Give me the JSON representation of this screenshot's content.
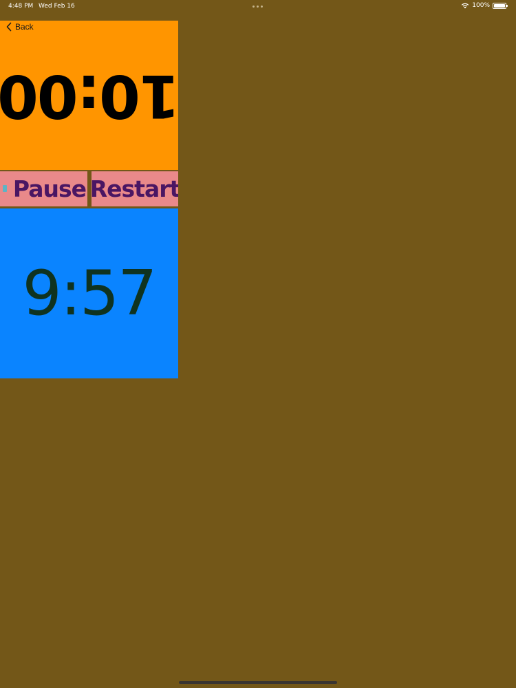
{
  "status_bar": {
    "time": "4:48 PM",
    "date": "Wed Feb 16",
    "battery": "100%",
    "icons": [
      "wifi-icon",
      "battery-icon"
    ]
  },
  "nav": {
    "back_label": "Back",
    "back_icon": "chevron-left-icon"
  },
  "timers": {
    "top": {
      "time": "10:00",
      "rotated": true,
      "color": "#ff9500"
    },
    "bottom": {
      "time": "9:57",
      "color": "#0a84ff"
    }
  },
  "controls": {
    "pause_label": "Pause",
    "restart_label": "Restart",
    "button_color": "#e9898a",
    "text_color": "#4a1663"
  },
  "colors": {
    "background": "#735718"
  }
}
